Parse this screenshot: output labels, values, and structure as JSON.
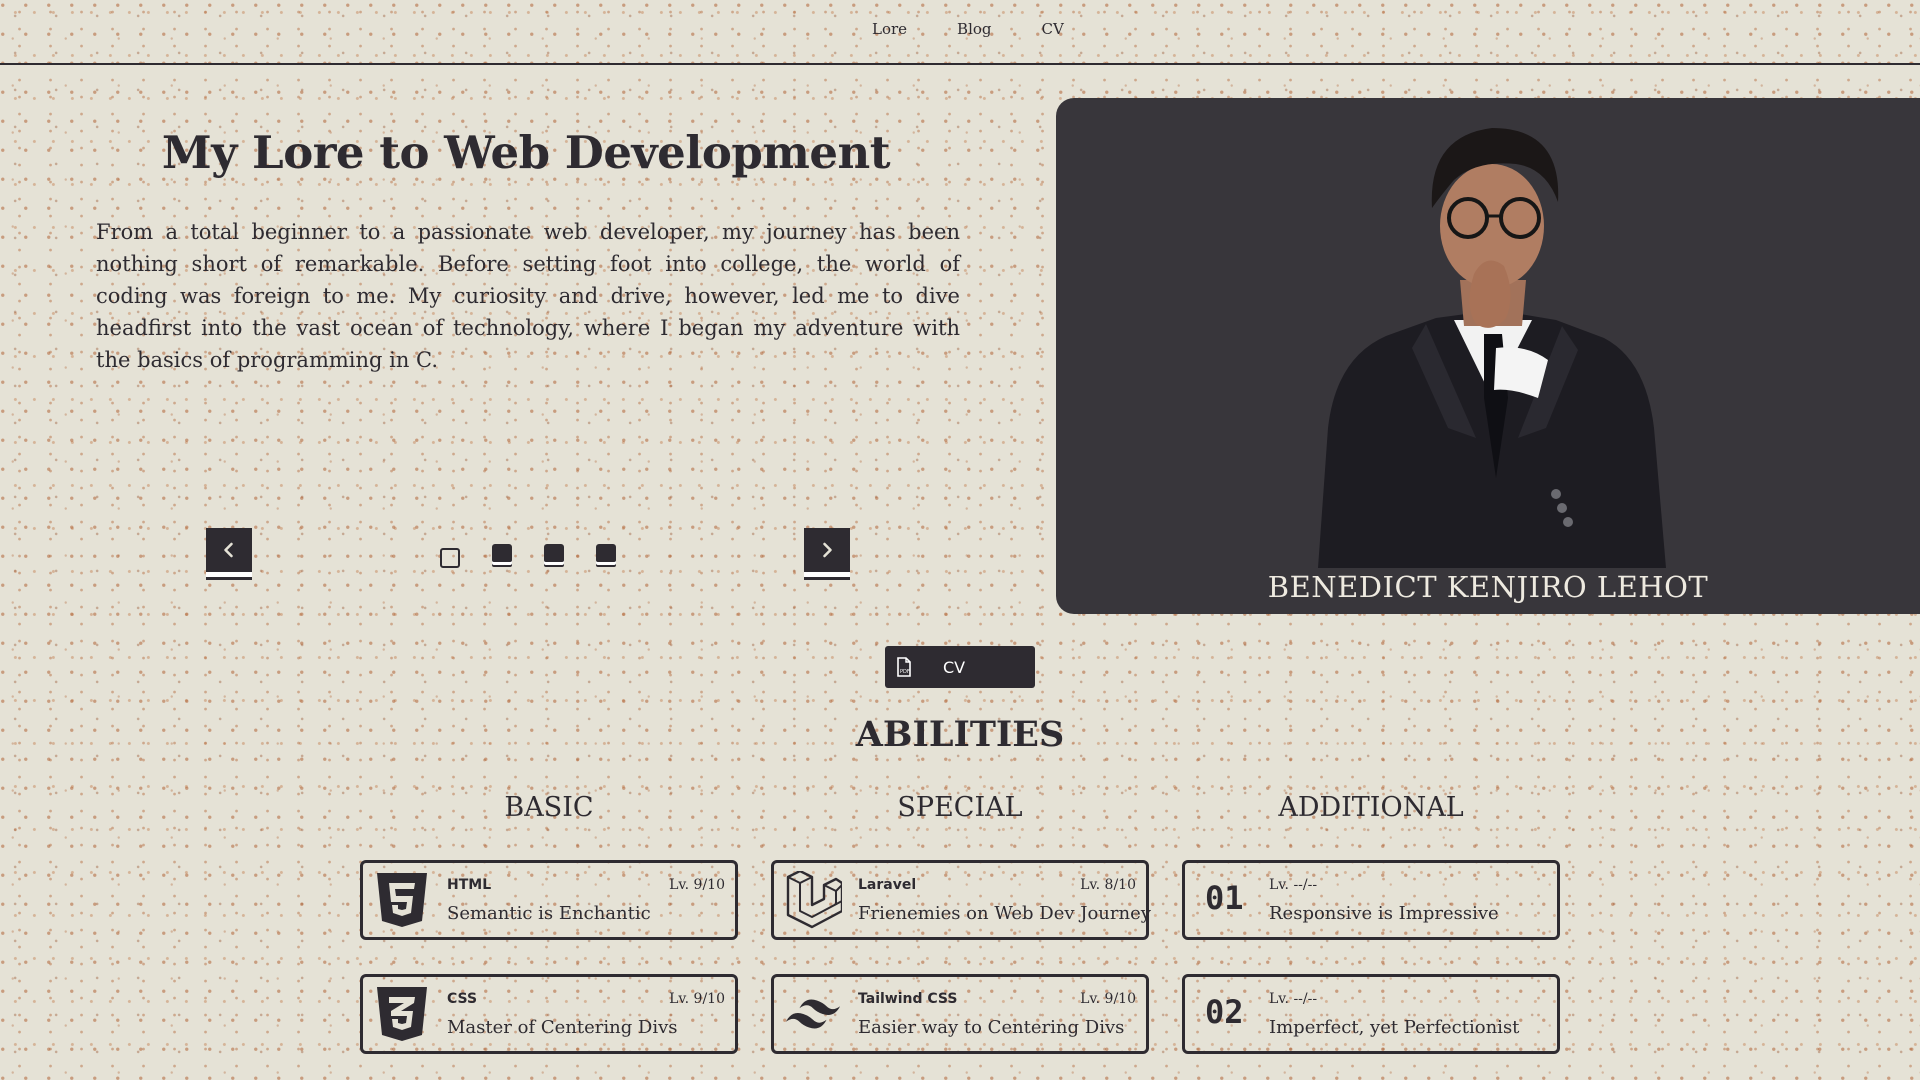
{
  "nav": {
    "links": [
      "Lore",
      "Blog",
      "CV"
    ]
  },
  "hero": {
    "title": "My Lore to Web Development",
    "text": "From a total beginner to a passionate web developer, my journey has been nothing short of remarkable. Before setting foot into college, the world of coding was foreign to me. My curiosity and drive, however, led me to dive headfirst into the vast ocean of technology, where I began my adventure with the basics of programming in C."
  },
  "carousel": {
    "prev_icon": "chevron-left-icon",
    "next_icon": "chevron-right-icon",
    "slide_count": 4,
    "active_index": 0
  },
  "profile": {
    "name": "BENEDICT KENJIRO LEHOT"
  },
  "cv_button": {
    "icon": "pdf-file-icon",
    "label": "CV"
  },
  "abilities": {
    "title": "ABILITIES",
    "columns": [
      {
        "title": "BASIC",
        "cards": [
          {
            "icon": "html5-icon",
            "name": "HTML",
            "level": "Lv. 9/10",
            "desc": "Semantic is Enchantic"
          },
          {
            "icon": "css3-icon",
            "name": "CSS",
            "level": "Lv. 9/10",
            "desc": "Master of Centering Divs"
          }
        ]
      },
      {
        "title": "SPECIAL",
        "cards": [
          {
            "icon": "laravel-icon",
            "name": "Laravel",
            "level": "Lv. 8/10",
            "desc": "Frienemies on Web Dev Journey"
          },
          {
            "icon": "tailwind-icon",
            "name": "Tailwind CSS",
            "level": "Lv. 9/10",
            "desc": "Easier way to Centering Divs"
          }
        ]
      },
      {
        "title": "ADDITIONAL",
        "cards": [
          {
            "num": "01",
            "level": "Lv. --/--",
            "desc": "Responsive is Impressive"
          },
          {
            "num": "02",
            "level": "Lv. --/--",
            "desc": "Imperfect, yet Perfectionist"
          }
        ]
      }
    ]
  },
  "colors": {
    "background": "#e5e2d6",
    "ink": "#2e2b31",
    "photo_bg": "#38363b",
    "speckle": "#b06234"
  }
}
